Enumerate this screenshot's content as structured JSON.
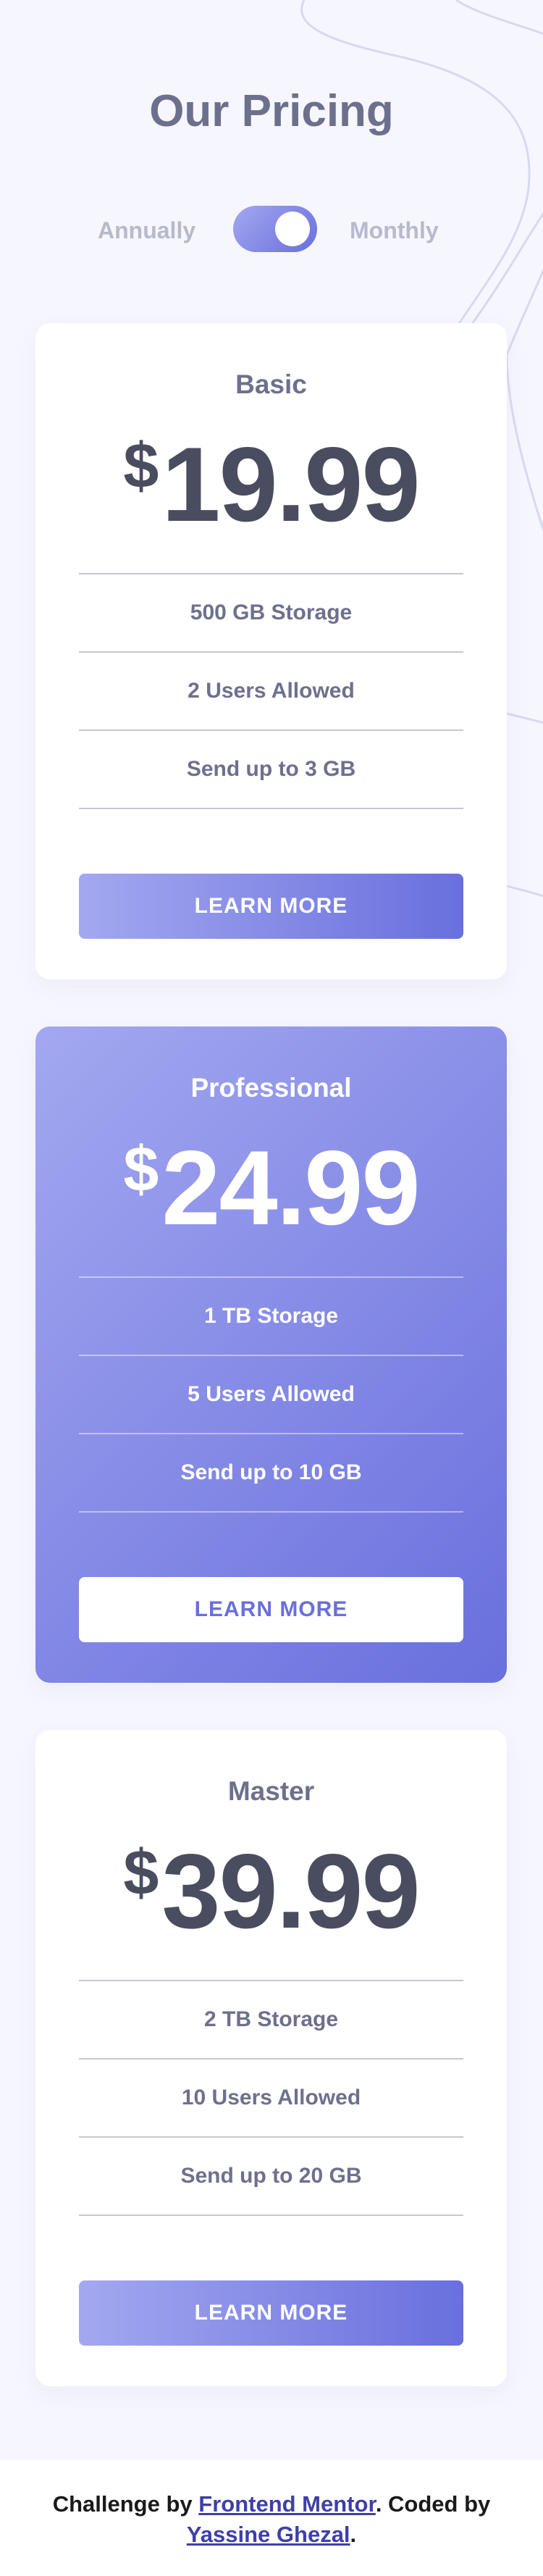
{
  "header": {
    "title": "Our Pricing"
  },
  "billing_toggle": {
    "left_label": "Annually",
    "right_label": "Monthly",
    "selected": "Monthly"
  },
  "plans": [
    {
      "name": "Basic",
      "currency": "$",
      "price": "19.99",
      "features": [
        "500 GB Storage",
        "2 Users Allowed",
        "Send up to 3 GB"
      ],
      "button_label": "LEARN MORE"
    },
    {
      "name": "Professional",
      "currency": "$",
      "price": "24.99",
      "features": [
        "1 TB Storage",
        "5 Users Allowed",
        "Send up to 10 GB"
      ],
      "button_label": "LEARN MORE"
    },
    {
      "name": "Master",
      "currency": "$",
      "price": "39.99",
      "features": [
        "2 TB Storage",
        "10 Users Allowed",
        "Send up to 20 GB"
      ],
      "button_label": "LEARN MORE"
    }
  ],
  "footer": {
    "prefix": "Challenge by ",
    "link1": "Frontend Mentor",
    "middle": ". Coded by ",
    "link2": "Yassine Ghezal",
    "suffix": "."
  },
  "colors": {
    "background": "#f6f6fe",
    "gradient_start": "#a3a8f0",
    "gradient_end": "#696fdd",
    "heading": "#6d708d",
    "price": "#4a4d60",
    "link": "#3e3fa8"
  }
}
